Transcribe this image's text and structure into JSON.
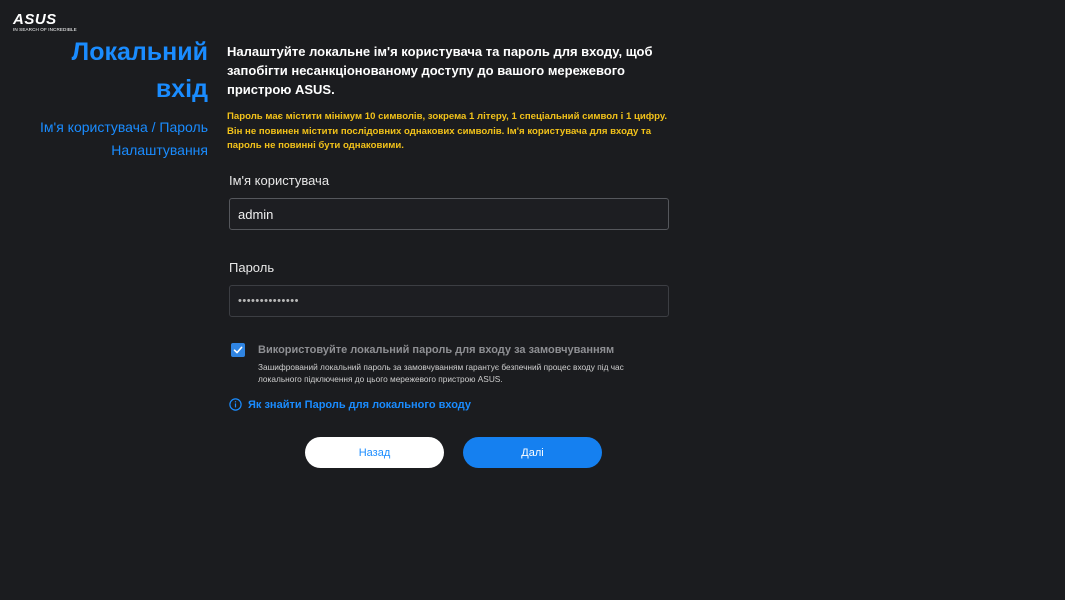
{
  "logo": {
    "brand": "ASUS",
    "tagline": "IN SEARCH OF INCREDIBLE"
  },
  "sidebar": {
    "title_line1": "Локальний",
    "title_line2": "вхід",
    "steps": [
      {
        "label": "Ім'я користувача / Пароль"
      },
      {
        "label": "Налаштування"
      }
    ]
  },
  "main": {
    "intro": "Налаштуйте локальне ім'я користувача та пароль для входу, щоб запобігти несанкціонованому доступу до вашого мережевого пристрою ASUS.",
    "warning": "Пароль має містити мінімум 10 символів, зокрема 1 літеру, 1 спеціальний символ і 1 цифру. Він не повинен містити послідовних однакових символів. Ім'я користувача для входу та пароль не повинні бути однаковими.",
    "username": {
      "label": "Ім'я користувача",
      "value": "admin"
    },
    "password": {
      "label": "Пароль",
      "value": "••••••••••••••"
    },
    "default_password": {
      "checked": true,
      "label": "Використовуйте локальний пароль для входу за замовчуванням",
      "description": "Зашифрований локальний пароль за замовчуванням гарантує безпечний процес входу під час локального підключення до цього мережевого пристрою ASUS."
    },
    "help_link": "Як знайти Пароль для локального входу",
    "buttons": {
      "back": "Назад",
      "next": "Далі"
    }
  },
  "colors": {
    "background": "#1b1c1f",
    "accent": "#1a8cff",
    "warning": "#f2c21a",
    "primary_button": "#1580f0"
  }
}
